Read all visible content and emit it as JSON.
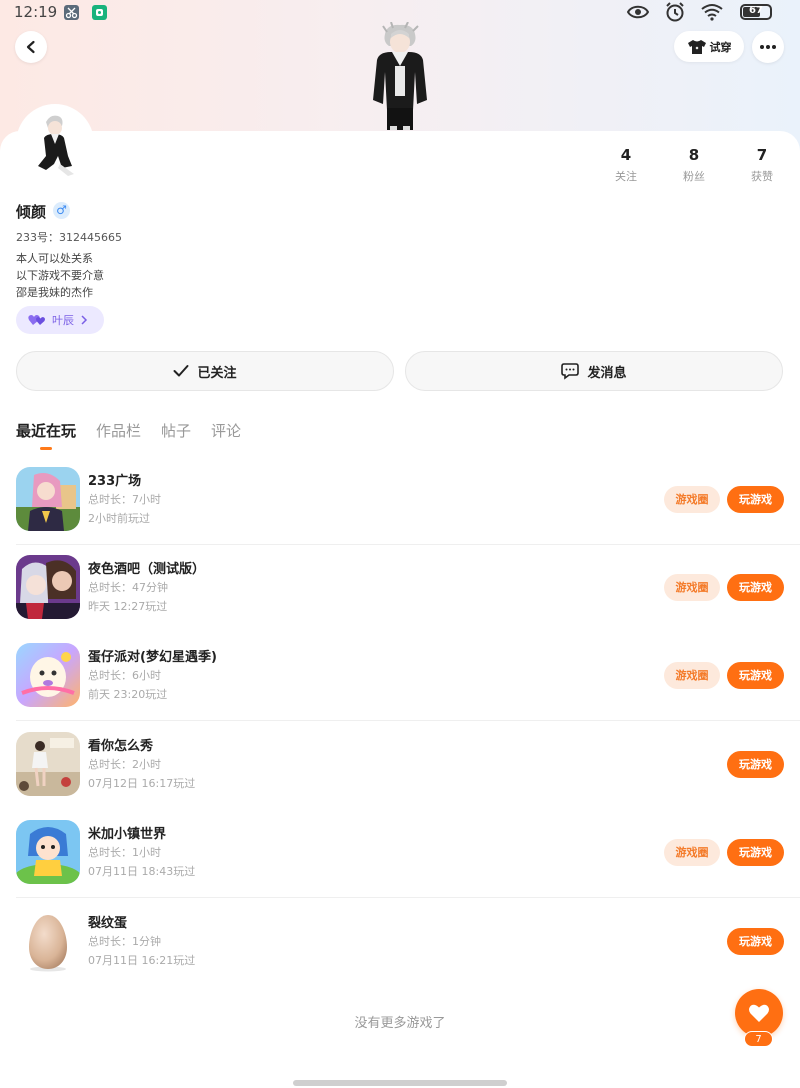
{
  "status_bar": {
    "time": "12:19",
    "battery": "67",
    "battery_fraction": 0.67,
    "icons": [
      "eye-icon",
      "alarm-icon",
      "wifi-icon",
      "battery-icon"
    ]
  },
  "header": {
    "back_icon": "chevron-left-icon",
    "try_on_label": "试穿",
    "try_on_icon": "shirt-icon",
    "more_icon": "more-dots-icon"
  },
  "profile": {
    "name": "倾颜",
    "gender_symbol": "♂",
    "uid": "233号：312445665",
    "bio": [
      "本人可以处关系",
      "以下游戏不要介意",
      "邵是我妹的杰作"
    ],
    "relation_tag": "叶辰",
    "stats": [
      {
        "num": "4",
        "label": "关注"
      },
      {
        "num": "8",
        "label": "粉丝"
      },
      {
        "num": "7",
        "label": "获赞"
      }
    ]
  },
  "actions": {
    "follow_label": "已关注",
    "message_label": "发消息"
  },
  "tabs": [
    "最近在玩",
    "作品栏",
    "帖子",
    "评论"
  ],
  "games": [
    {
      "name": "233广场",
      "duration": "总时长：7小时",
      "last_played": "2小时前玩过",
      "has_circle": true
    },
    {
      "name": "夜色酒吧（测试版）",
      "duration": "总时长：47分钟",
      "last_played": "昨天 12:27玩过",
      "has_circle": true
    },
    {
      "name": "蛋仔派对(梦幻星遇季)",
      "duration": "总时长：6小时",
      "last_played": "前天 23:20玩过",
      "has_circle": true
    },
    {
      "name": "看你怎么秀",
      "duration": "总时长：2小时",
      "last_played": "07月12日 16:17玩过",
      "has_circle": false
    },
    {
      "name": "米加小镇世界",
      "duration": "总时长：1小时",
      "last_played": "07月11日 18:43玩过",
      "has_circle": true
    },
    {
      "name": "裂纹蛋",
      "duration": "总时长：1分钟",
      "last_played": "07月11日 16:21玩过",
      "has_circle": false
    }
  ],
  "buttons": {
    "game_circle": "游戏圈",
    "play_game": "玩游戏"
  },
  "footer": {
    "no_more": "没有更多游戏了",
    "like_count": "7"
  },
  "colors": {
    "accent": "#ff6f12",
    "circle_bg": "#fde9dc",
    "relation_purple": "#7a5fe6"
  }
}
